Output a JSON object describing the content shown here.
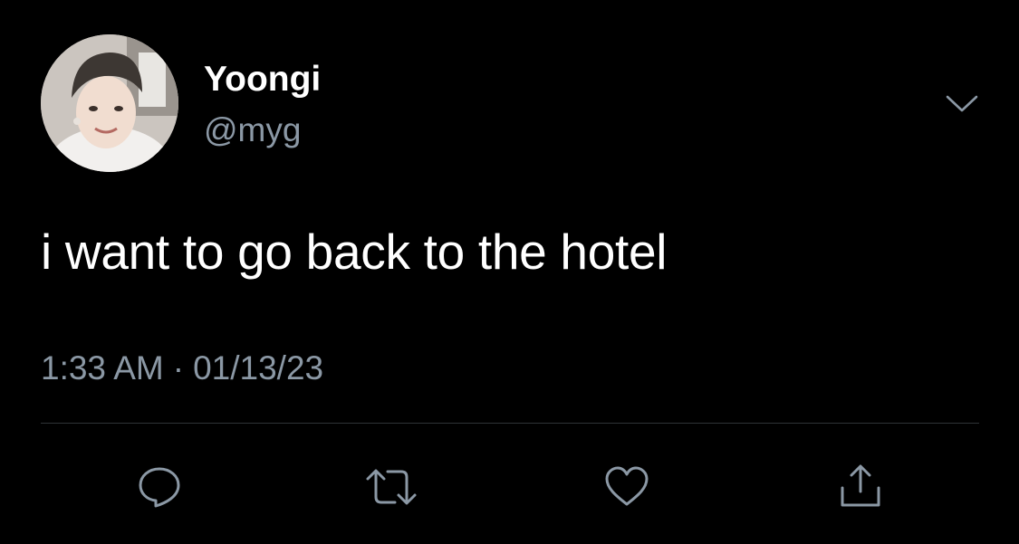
{
  "tweet": {
    "author": {
      "display_name": "Yoongi",
      "handle": "@myg",
      "avatar_icon": "profile-photo"
    },
    "text": "i want to go back to the hotel",
    "time": "1:33 AM",
    "separator": "·",
    "date": "01/13/23"
  },
  "actions": [
    {
      "name": "reply",
      "icon": "speech-bubble-icon"
    },
    {
      "name": "retweet",
      "icon": "retweet-arrows-icon"
    },
    {
      "name": "like",
      "icon": "heart-icon"
    },
    {
      "name": "share",
      "icon": "share-upload-icon"
    }
  ],
  "colors": {
    "background": "#000000",
    "primary_text": "#ffffff",
    "secondary_text": "#8b98a5",
    "divider": "#2f3336"
  }
}
